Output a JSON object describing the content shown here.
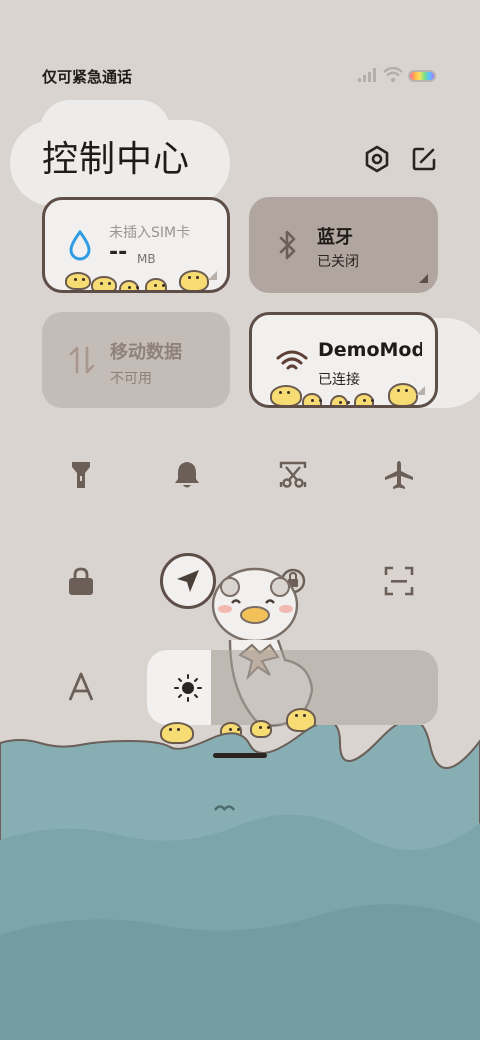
{
  "status_bar": {
    "carrier_text": "仅可紧急通话",
    "icons": [
      "signal-icon",
      "wifi-icon",
      "battery-icon"
    ]
  },
  "header": {
    "title": "控制中心",
    "settings_icon": "settings-hex-icon",
    "edit_icon": "edit-icon"
  },
  "tiles": {
    "data_usage": {
      "label": "未插入SIM卡",
      "value": "--",
      "unit": "MB",
      "icon": "water-drop-icon"
    },
    "bluetooth": {
      "label": "蓝牙",
      "status": "已关闭",
      "icon": "bluetooth-icon"
    },
    "mobile_data": {
      "label": "移动数据",
      "status": "不可用",
      "icon": "mobile-data-icon"
    },
    "wifi": {
      "label": "DemoMod",
      "status": "已连接",
      "icon": "wifi-icon"
    }
  },
  "toggles": [
    {
      "name": "flashlight",
      "icon": "flashlight-icon"
    },
    {
      "name": "ring",
      "icon": "bell-icon"
    },
    {
      "name": "screenshot",
      "icon": "scissors-screenshot-icon"
    },
    {
      "name": "airplane",
      "icon": "airplane-icon"
    },
    {
      "name": "lock",
      "icon": "lock-icon"
    },
    {
      "name": "location",
      "icon": "location-arrow-icon"
    },
    {
      "name": "rotation",
      "icon": "rotation-lock-icon"
    },
    {
      "name": "scan",
      "icon": "scan-icon"
    }
  ],
  "brightness": {
    "font_icon": "font-size-icon",
    "icon": "sun-icon",
    "level": 0.22
  },
  "colors": {
    "background": "#d9d4cf",
    "water": "#7ea6ab",
    "tile_active": "#f2f0ee",
    "tile_inactive": "#b0a69f",
    "icon_brown": "#6b5f58",
    "blue_accent": "#2f9be3"
  }
}
